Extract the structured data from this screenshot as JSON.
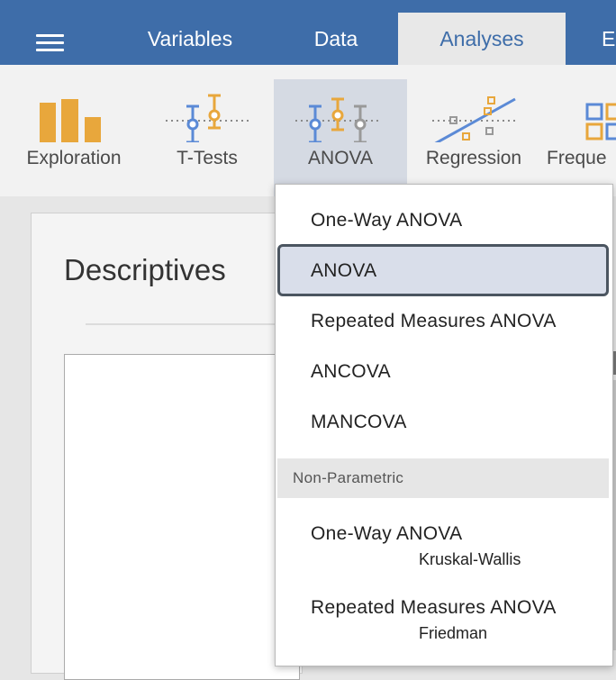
{
  "tabs": [
    {
      "label": "Variables"
    },
    {
      "label": "Data"
    },
    {
      "label": "Analyses"
    },
    {
      "label": "E"
    }
  ],
  "ribbon": [
    {
      "label": "Exploration",
      "icon": "exploration-bars-icon"
    },
    {
      "label": "T-Tests",
      "icon": "ttests-icon"
    },
    {
      "label": "ANOVA",
      "icon": "anova-icon"
    },
    {
      "label": "Regression",
      "icon": "regression-icon"
    },
    {
      "label": "Freque",
      "icon": "frequencies-icon"
    }
  ],
  "panel": {
    "title": "Descriptives"
  },
  "menu": {
    "items": [
      {
        "label": "One-Way ANOVA"
      },
      {
        "label": "ANOVA"
      },
      {
        "label": "Repeated Measures ANOVA"
      },
      {
        "label": "ANCOVA"
      },
      {
        "label": "MANCOVA"
      }
    ],
    "section_label": "Non-Parametric",
    "nonparam": [
      {
        "label": "One-Way ANOVA",
        "sub": "Kruskal-Wallis"
      },
      {
        "label": "Repeated Measures ANOVA",
        "sub": "Friedman"
      }
    ]
  },
  "colors": {
    "accent": "#3e6da9",
    "orange": "#e8a73c",
    "blue": "#5b8ad6",
    "gray": "#999999"
  }
}
